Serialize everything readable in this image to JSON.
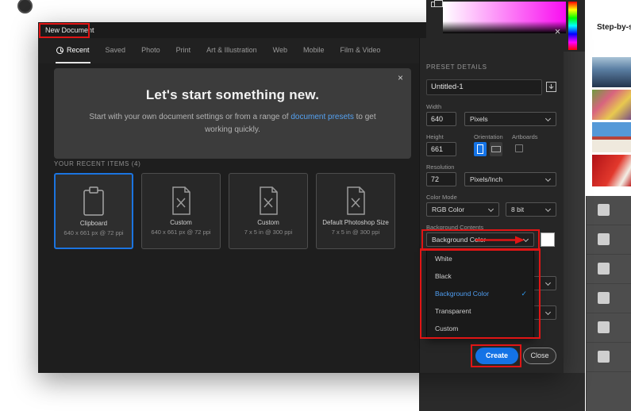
{
  "colors": {
    "annotation": "#e01515",
    "accent": "#1473e6",
    "link": "#55a1f0"
  },
  "workspace": {
    "step_panel_text": "Step-by-s",
    "dialog_close_icon": "×"
  },
  "dialog": {
    "title": "New Document",
    "tabs": [
      {
        "label": "Recent"
      },
      {
        "label": "Saved"
      },
      {
        "label": "Photo"
      },
      {
        "label": "Print"
      },
      {
        "label": "Art & Illustration"
      },
      {
        "label": "Web"
      },
      {
        "label": "Mobile"
      },
      {
        "label": "Film & Video"
      }
    ],
    "hero": {
      "close_icon": "×",
      "title": "Let's start something new.",
      "text_before": "Start with your own document settings or from a range of ",
      "link_text": "document presets",
      "text_after": " to get working quickly."
    },
    "recent_section": {
      "header": "YOUR RECENT ITEMS (4)",
      "items": [
        {
          "name": "Clipboard",
          "spec": "640 x 661 px @ 72 ppi"
        },
        {
          "name": "Custom",
          "spec": "640 x 661 px @ 72 ppi"
        },
        {
          "name": "Custom",
          "spec": "7 x 5 in @ 300 ppi"
        },
        {
          "name": "Default Photoshop Size",
          "spec": "7 x 5 in @ 300 ppi"
        }
      ]
    },
    "preset_details": {
      "header": "PRESET DETAILS",
      "name_value": "Untitled-1",
      "width_label": "Width",
      "width_value": "640",
      "unit_value": "Pixels",
      "height_label": "Height",
      "height_value": "661",
      "orientation_label": "Orientation",
      "artboards_label": "Artboards",
      "resolution_label": "Resolution",
      "resolution_value": "72",
      "resolution_unit": "Pixels/Inch",
      "color_mode_label": "Color Mode",
      "color_mode_value": "RGB Color",
      "bit_depth_value": "8 bit",
      "background_label": "Background Contents",
      "background_value": "Background Color",
      "check_icon": "✓",
      "menu_options": [
        {
          "label": "White"
        },
        {
          "label": "Black"
        },
        {
          "label": "Background Color"
        },
        {
          "label": "Transparent"
        },
        {
          "label": "Custom"
        }
      ],
      "create_label": "Create",
      "close_label": "Close"
    }
  }
}
